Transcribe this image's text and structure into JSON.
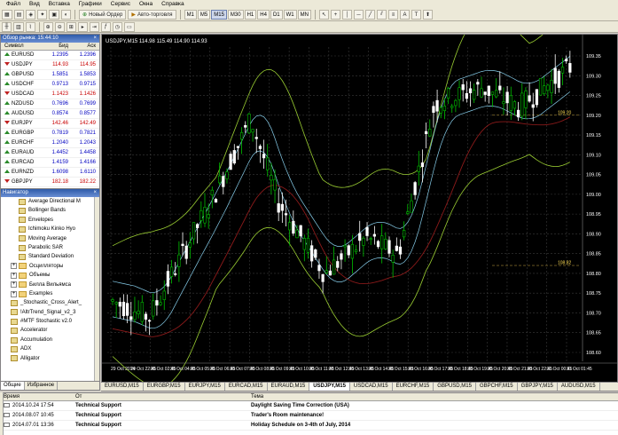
{
  "menu": [
    "Файл",
    "Вид",
    "Вставка",
    "Графики",
    "Сервис",
    "Окна",
    "Справка"
  ],
  "toolbar": {
    "new_order": "Новый Ордер",
    "autotrading": "Авто-торговля",
    "timeframes": [
      "M1",
      "M5",
      "M15",
      "M30",
      "H1",
      "H4",
      "D1",
      "W1",
      "MN"
    ],
    "active_timeframe": "M15"
  },
  "market_watch": {
    "title": "Обзор рынка: 15:44:10",
    "headers": {
      "symbol": "Символ",
      "bid": "Бид",
      "ask": "Аск"
    },
    "rows": [
      {
        "symbol": "EURUSD",
        "bid": "1.2395",
        "ask": "1.2396",
        "dir": "up",
        "color": "blue"
      },
      {
        "symbol": "USDJPY",
        "bid": "114.93",
        "ask": "114.95",
        "dir": "down",
        "color": "red"
      },
      {
        "symbol": "GBPUSD",
        "bid": "1.5851",
        "ask": "1.5853",
        "dir": "up",
        "color": "blue"
      },
      {
        "symbol": "USDCHF",
        "bid": "0.9713",
        "ask": "0.9715",
        "dir": "up",
        "color": "blue"
      },
      {
        "symbol": "USDCAD",
        "bid": "1.1423",
        "ask": "1.1426",
        "dir": "down",
        "color": "red"
      },
      {
        "symbol": "NZDUSD",
        "bid": "0.7696",
        "ask": "0.7699",
        "dir": "up",
        "color": "blue"
      },
      {
        "symbol": "AUDUSD",
        "bid": "0.8574",
        "ask": "0.8577",
        "dir": "up",
        "color": "blue"
      },
      {
        "symbol": "EURJPY",
        "bid": "142.46",
        "ask": "142.49",
        "dir": "down",
        "color": "red"
      },
      {
        "symbol": "EURGBP",
        "bid": "0.7819",
        "ask": "0.7821",
        "dir": "up",
        "color": "blue"
      },
      {
        "symbol": "EURCHF",
        "bid": "1.2040",
        "ask": "1.2043",
        "dir": "up",
        "color": "blue"
      },
      {
        "symbol": "EURAUD",
        "bid": "1.4452",
        "ask": "1.4458",
        "dir": "up",
        "color": "blue"
      },
      {
        "symbol": "EURCAD",
        "bid": "1.4159",
        "ask": "1.4166",
        "dir": "up",
        "color": "blue"
      },
      {
        "symbol": "EURNZD",
        "bid": "1.6098",
        "ask": "1.6110",
        "dir": "up",
        "color": "blue"
      },
      {
        "symbol": "GBPJPY",
        "bid": "182.18",
        "ask": "182.22",
        "dir": "down",
        "color": "red"
      },
      {
        "symbol": "GBPCHF",
        "bid": "1.5395",
        "ask": "1.5401",
        "dir": "up",
        "color": "blue"
      },
      {
        "symbol": "CHFJPY",
        "bid": "118.30",
        "ask": "118.34",
        "dir": "down",
        "color": "red"
      }
    ],
    "tabs": [
      "Символы",
      "Тиковый график"
    ]
  },
  "navigator": {
    "title": "Навигатор",
    "items": [
      {
        "label": "Average Directional M",
        "kind": "ind",
        "indent": 2
      },
      {
        "label": "Bollinger Bands",
        "kind": "ind",
        "indent": 2
      },
      {
        "label": "Envelopes",
        "kind": "ind",
        "indent": 2
      },
      {
        "label": "Ichimoku Kinko Hyo",
        "kind": "ind",
        "indent": 2
      },
      {
        "label": "Moving Average",
        "kind": "ind",
        "indent": 2
      },
      {
        "label": "Parabolic SAR",
        "kind": "ind",
        "indent": 2
      },
      {
        "label": "Standard Deviation",
        "kind": "ind",
        "indent": 2
      },
      {
        "label": "Осцилляторы",
        "kind": "fold",
        "indent": 1,
        "exp": "+"
      },
      {
        "label": "Объемы",
        "kind": "fold",
        "indent": 1,
        "exp": "+"
      },
      {
        "label": "Билла Вильямса",
        "kind": "fold",
        "indent": 1,
        "exp": "+"
      },
      {
        "label": "Examples",
        "kind": "fold",
        "indent": 1,
        "exp": "+"
      },
      {
        "label": "_Stochastic_Cross_Alert_",
        "kind": "ind",
        "indent": 1
      },
      {
        "label": "!AltrTrend_Signal_v2_3",
        "kind": "ind",
        "indent": 1
      },
      {
        "label": "#MTF Stochastic v2.0",
        "kind": "ind",
        "indent": 1
      },
      {
        "label": "Accelerator",
        "kind": "ind",
        "indent": 1
      },
      {
        "label": "Accumulation",
        "kind": "ind",
        "indent": 1
      },
      {
        "label": "ADX",
        "kind": "ind",
        "indent": 1
      },
      {
        "label": "Alligator",
        "kind": "ind",
        "indent": 1
      }
    ],
    "tabs": [
      "Общие",
      "Избранное"
    ]
  },
  "chart": {
    "title": "USDJPY,M15  114.98 115.49 114.90 114.93",
    "window_tabs": [
      "EURUSD,M15",
      "EURGBP,M15",
      "EURJPY,M15",
      "EURCAD,M15",
      "EURAUD,M15",
      "USDJPY,M15",
      "USDCAD,M15",
      "EURCHF,M15",
      "GBPUSD,M15",
      "GBPCHF,M15",
      "GBPJPY,M15",
      "AUDUSD,M15"
    ],
    "active_tab": "USDJPY,M15",
    "price_labels": [
      "109.35",
      "109.30",
      "109.25",
      "109.20",
      "109.15",
      "109.10",
      "109.05",
      "109.00",
      "108.95",
      "108.90",
      "108.85",
      "108.80",
      "108.75",
      "108.70",
      "108.65",
      "108.60"
    ],
    "time_labels": [
      "29 Oct 2014",
      "29 Oct 22:45",
      "30 Oct 02:45",
      "30 Oct 04:45",
      "30 Oct 05:45",
      "30 Oct 06:45",
      "30 Oct 07:45",
      "30 Oct 08:45",
      "30 Oct 09:45",
      "30 Oct 10:45",
      "30 Oct 11:45",
      "30 Oct 12:45",
      "30 Oct 13:45",
      "30 Oct 14:45",
      "30 Oct 15:45",
      "30 Oct 16:45",
      "30 Oct 17:45",
      "30 Oct 18:45",
      "30 Oct 19:45",
      "30 Oct 20:45",
      "30 Oct 21:45",
      "30 Oct 22:45",
      "31 Oct 00:45",
      "31 Oct 01:45"
    ],
    "level_labels": [
      "109.20",
      "108.82"
    ],
    "colors": {
      "bg": "#000000",
      "bull": "#00c000",
      "bear": "#ffffff",
      "band": "#9acd32",
      "ma1": "#87ceeb",
      "ma2": "#8b1a1a",
      "grid": "#3a3a3a"
    }
  },
  "terminal": {
    "headers": {
      "time": "Время",
      "from": "От",
      "subject": "Тема"
    },
    "rows": [
      {
        "time": "2014.10.24 17:54",
        "from": "Technical Support",
        "subject": "Daylight Saving Time Correction (USA)"
      },
      {
        "time": "2014.08.07 10:45",
        "from": "Technical Support",
        "subject": "Trader's Room maintenance!"
      },
      {
        "time": "2014.07.01 13:36",
        "from": "Technical Support",
        "subject": "Holiday Schedule on 3-4th of July, 2014"
      }
    ]
  }
}
